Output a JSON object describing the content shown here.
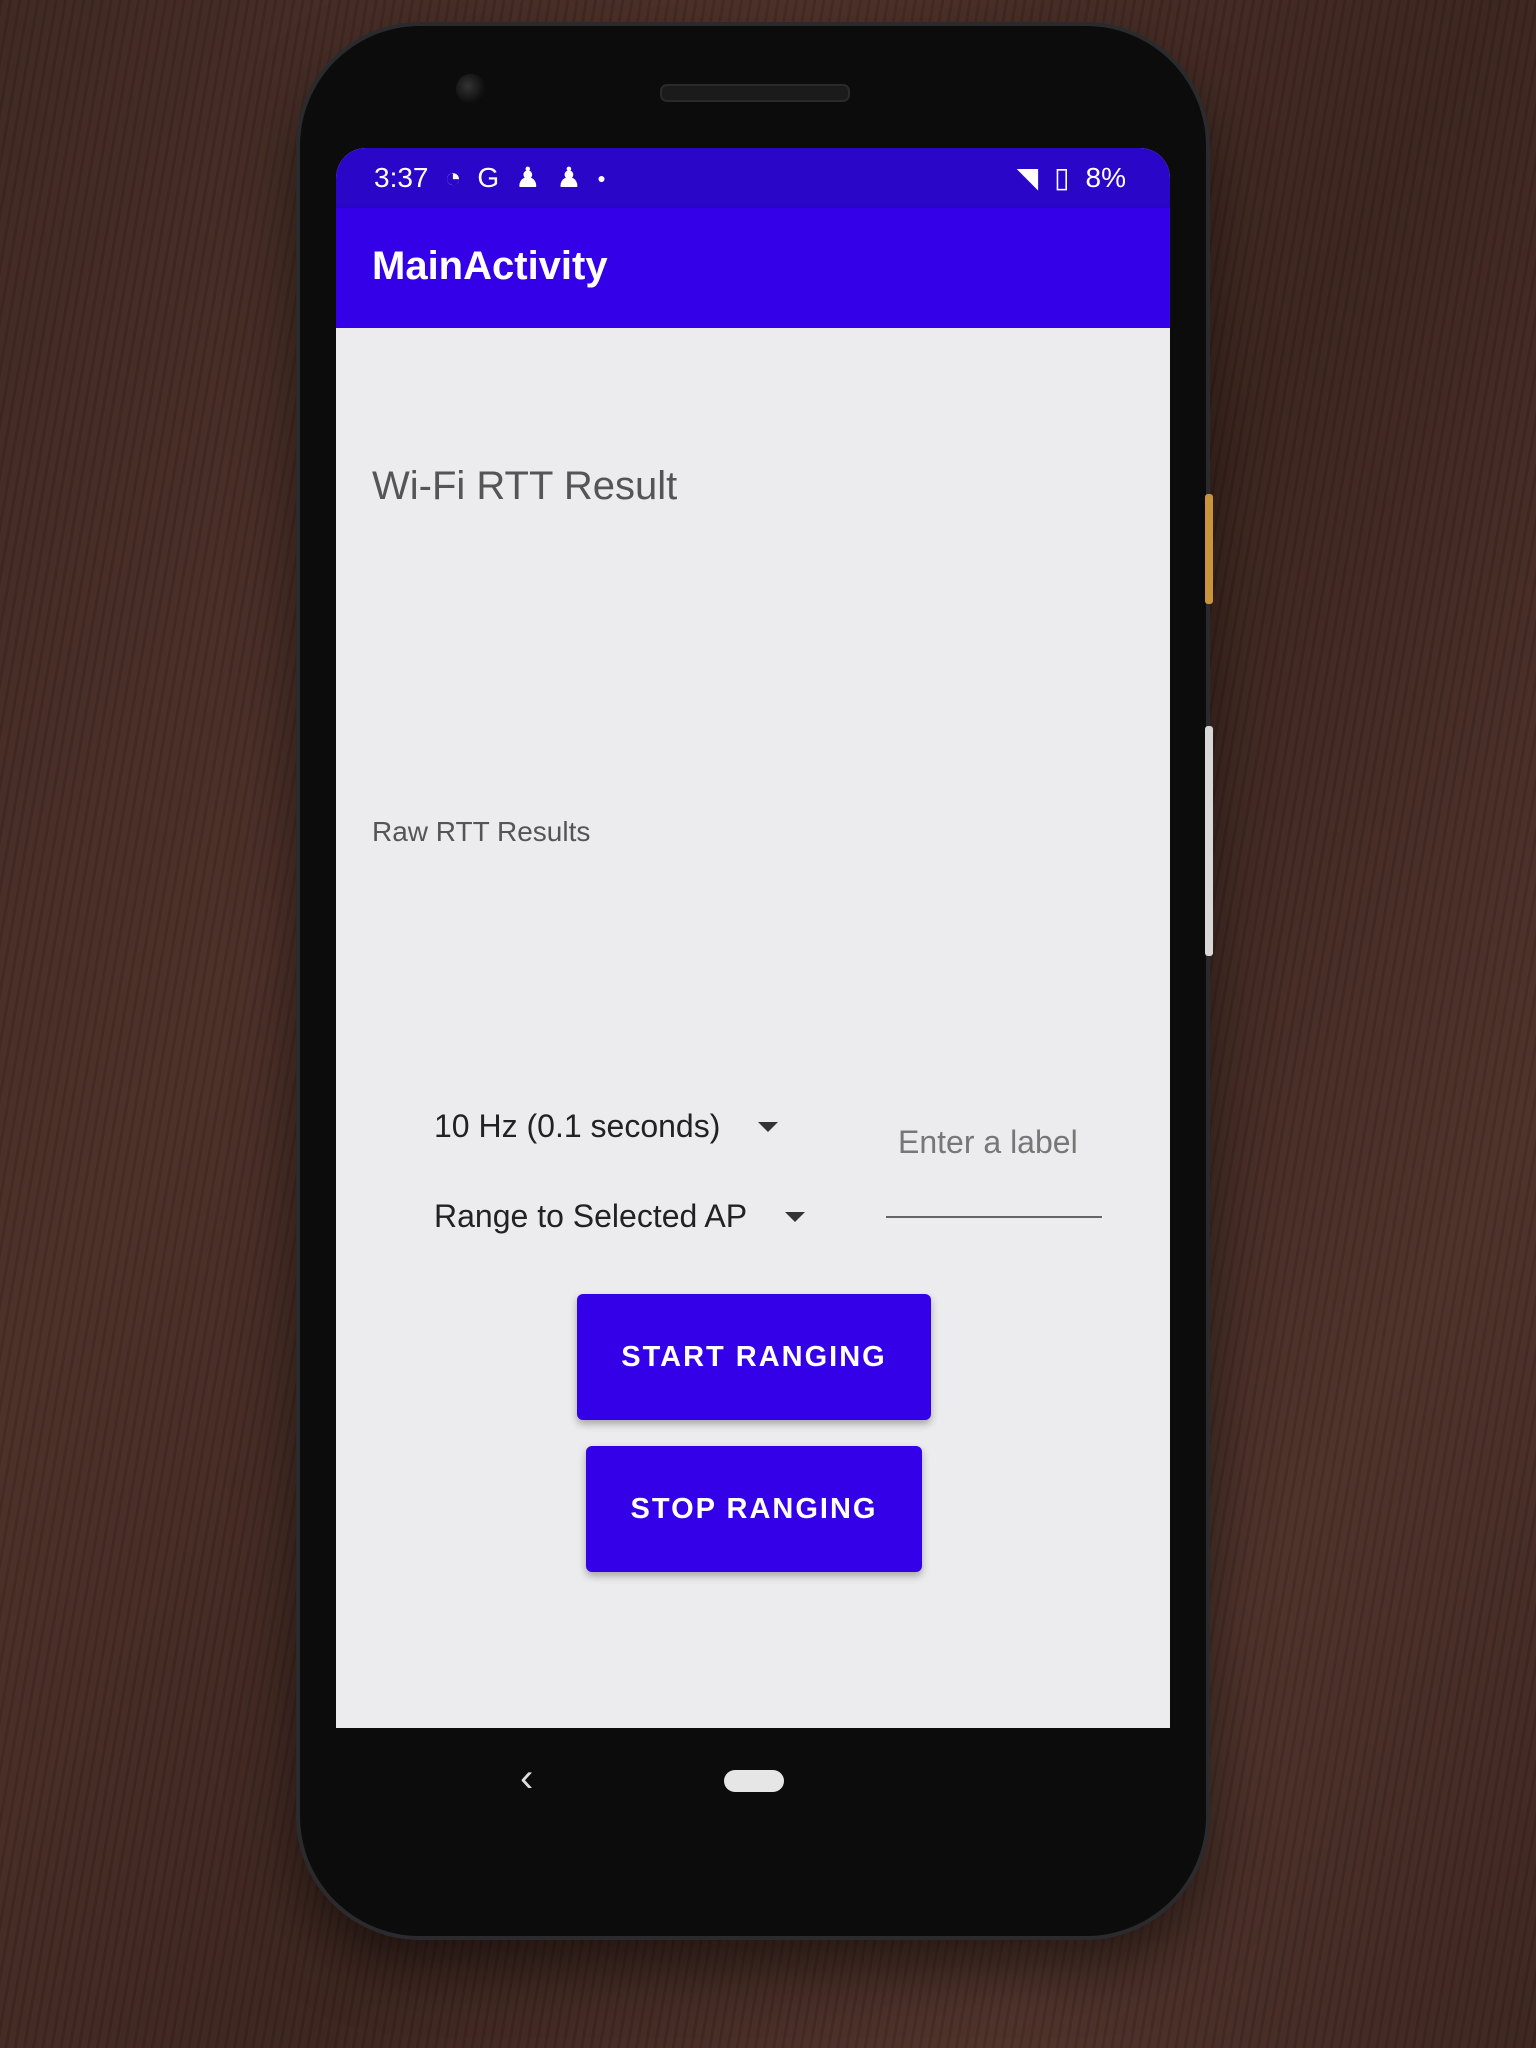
{
  "status_bar": {
    "time": "3:37",
    "left_icons": [
      "wifi-question-icon",
      "google-icon",
      "notification-person-icon",
      "notification-person-icon",
      "dot-icon"
    ],
    "right_icons": [
      "wifi-icon",
      "battery-icon"
    ],
    "battery": "8%"
  },
  "app_bar": {
    "title": "MainActivity"
  },
  "main": {
    "result_title": "Wi-Fi RTT Result",
    "raw_results_label": "Raw RTT Results",
    "frequency_spinner": "10 Hz (0.1 seconds)",
    "mode_spinner": "Range to Selected AP",
    "label_input": {
      "value": "",
      "placeholder": "Enter a label"
    },
    "start_button": "START RANGING",
    "stop_button": "STOP RANGING"
  },
  "nav": {
    "back_icon": "back-icon",
    "home_icon": "home-pill-icon"
  },
  "colors": {
    "status_bar": "#2a06c9",
    "app_bar": "#3300e8",
    "button": "#3300e8",
    "background": "#ececee"
  }
}
